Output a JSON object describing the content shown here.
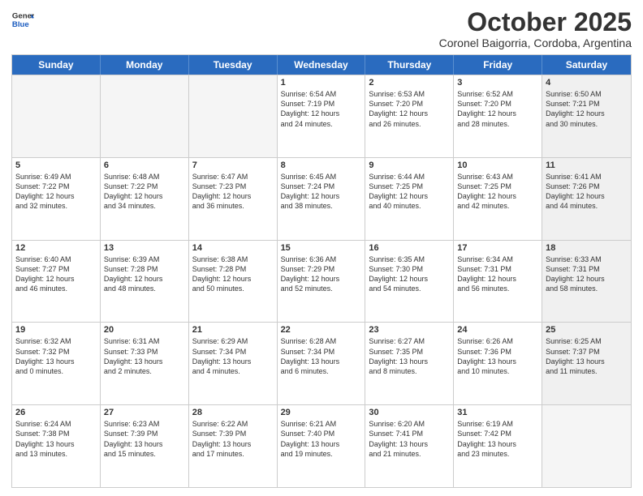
{
  "header": {
    "logo_general": "General",
    "logo_blue": "Blue",
    "month": "October 2025",
    "location": "Coronel Baigorria, Cordoba, Argentina"
  },
  "weekdays": [
    "Sunday",
    "Monday",
    "Tuesday",
    "Wednesday",
    "Thursday",
    "Friday",
    "Saturday"
  ],
  "rows": [
    [
      {
        "day": "",
        "text": "",
        "empty": true
      },
      {
        "day": "",
        "text": "",
        "empty": true
      },
      {
        "day": "",
        "text": "",
        "empty": true
      },
      {
        "day": "1",
        "text": "Sunrise: 6:54 AM\nSunset: 7:19 PM\nDaylight: 12 hours\nand 24 minutes."
      },
      {
        "day": "2",
        "text": "Sunrise: 6:53 AM\nSunset: 7:20 PM\nDaylight: 12 hours\nand 26 minutes."
      },
      {
        "day": "3",
        "text": "Sunrise: 6:52 AM\nSunset: 7:20 PM\nDaylight: 12 hours\nand 28 minutes."
      },
      {
        "day": "4",
        "text": "Sunrise: 6:50 AM\nSunset: 7:21 PM\nDaylight: 12 hours\nand 30 minutes.",
        "shaded": true
      }
    ],
    [
      {
        "day": "5",
        "text": "Sunrise: 6:49 AM\nSunset: 7:22 PM\nDaylight: 12 hours\nand 32 minutes."
      },
      {
        "day": "6",
        "text": "Sunrise: 6:48 AM\nSunset: 7:22 PM\nDaylight: 12 hours\nand 34 minutes."
      },
      {
        "day": "7",
        "text": "Sunrise: 6:47 AM\nSunset: 7:23 PM\nDaylight: 12 hours\nand 36 minutes."
      },
      {
        "day": "8",
        "text": "Sunrise: 6:45 AM\nSunset: 7:24 PM\nDaylight: 12 hours\nand 38 minutes."
      },
      {
        "day": "9",
        "text": "Sunrise: 6:44 AM\nSunset: 7:25 PM\nDaylight: 12 hours\nand 40 minutes."
      },
      {
        "day": "10",
        "text": "Sunrise: 6:43 AM\nSunset: 7:25 PM\nDaylight: 12 hours\nand 42 minutes."
      },
      {
        "day": "11",
        "text": "Sunrise: 6:41 AM\nSunset: 7:26 PM\nDaylight: 12 hours\nand 44 minutes.",
        "shaded": true
      }
    ],
    [
      {
        "day": "12",
        "text": "Sunrise: 6:40 AM\nSunset: 7:27 PM\nDaylight: 12 hours\nand 46 minutes."
      },
      {
        "day": "13",
        "text": "Sunrise: 6:39 AM\nSunset: 7:28 PM\nDaylight: 12 hours\nand 48 minutes."
      },
      {
        "day": "14",
        "text": "Sunrise: 6:38 AM\nSunset: 7:28 PM\nDaylight: 12 hours\nand 50 minutes."
      },
      {
        "day": "15",
        "text": "Sunrise: 6:36 AM\nSunset: 7:29 PM\nDaylight: 12 hours\nand 52 minutes."
      },
      {
        "day": "16",
        "text": "Sunrise: 6:35 AM\nSunset: 7:30 PM\nDaylight: 12 hours\nand 54 minutes."
      },
      {
        "day": "17",
        "text": "Sunrise: 6:34 AM\nSunset: 7:31 PM\nDaylight: 12 hours\nand 56 minutes."
      },
      {
        "day": "18",
        "text": "Sunrise: 6:33 AM\nSunset: 7:31 PM\nDaylight: 12 hours\nand 58 minutes.",
        "shaded": true
      }
    ],
    [
      {
        "day": "19",
        "text": "Sunrise: 6:32 AM\nSunset: 7:32 PM\nDaylight: 13 hours\nand 0 minutes."
      },
      {
        "day": "20",
        "text": "Sunrise: 6:31 AM\nSunset: 7:33 PM\nDaylight: 13 hours\nand 2 minutes."
      },
      {
        "day": "21",
        "text": "Sunrise: 6:29 AM\nSunset: 7:34 PM\nDaylight: 13 hours\nand 4 minutes."
      },
      {
        "day": "22",
        "text": "Sunrise: 6:28 AM\nSunset: 7:34 PM\nDaylight: 13 hours\nand 6 minutes."
      },
      {
        "day": "23",
        "text": "Sunrise: 6:27 AM\nSunset: 7:35 PM\nDaylight: 13 hours\nand 8 minutes."
      },
      {
        "day": "24",
        "text": "Sunrise: 6:26 AM\nSunset: 7:36 PM\nDaylight: 13 hours\nand 10 minutes."
      },
      {
        "day": "25",
        "text": "Sunrise: 6:25 AM\nSunset: 7:37 PM\nDaylight: 13 hours\nand 11 minutes.",
        "shaded": true
      }
    ],
    [
      {
        "day": "26",
        "text": "Sunrise: 6:24 AM\nSunset: 7:38 PM\nDaylight: 13 hours\nand 13 minutes."
      },
      {
        "day": "27",
        "text": "Sunrise: 6:23 AM\nSunset: 7:39 PM\nDaylight: 13 hours\nand 15 minutes."
      },
      {
        "day": "28",
        "text": "Sunrise: 6:22 AM\nSunset: 7:39 PM\nDaylight: 13 hours\nand 17 minutes."
      },
      {
        "day": "29",
        "text": "Sunrise: 6:21 AM\nSunset: 7:40 PM\nDaylight: 13 hours\nand 19 minutes."
      },
      {
        "day": "30",
        "text": "Sunrise: 6:20 AM\nSunset: 7:41 PM\nDaylight: 13 hours\nand 21 minutes."
      },
      {
        "day": "31",
        "text": "Sunrise: 6:19 AM\nSunset: 7:42 PM\nDaylight: 13 hours\nand 23 minutes."
      },
      {
        "day": "",
        "text": "",
        "empty": true,
        "shaded": true
      }
    ]
  ]
}
